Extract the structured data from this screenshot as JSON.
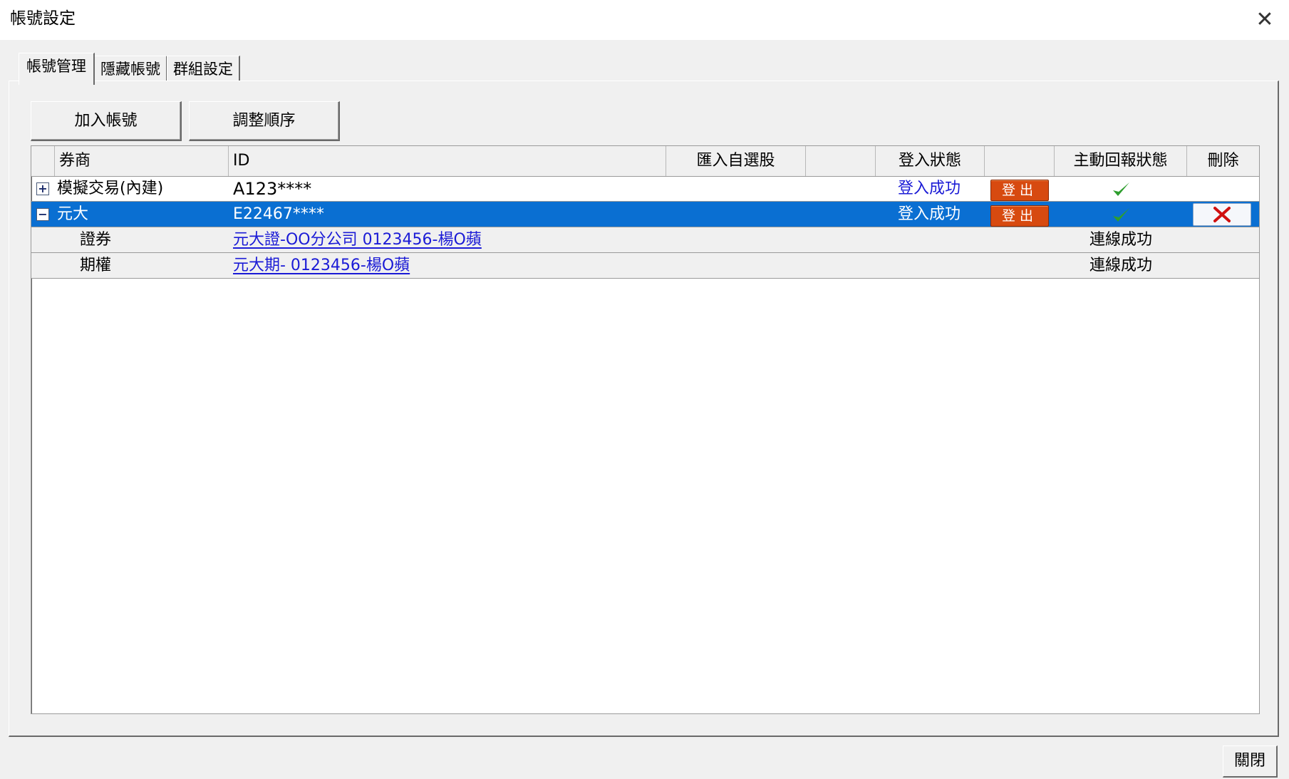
{
  "window": {
    "title": "帳號設定",
    "close_icon": "close-icon"
  },
  "tabs": [
    {
      "label": "帳號管理",
      "active": true
    },
    {
      "label": "隱藏帳號",
      "active": false
    },
    {
      "label": "群組設定",
      "active": false
    }
  ],
  "toolbar": {
    "add_label": "加入帳號",
    "reorder_label": "調整順序"
  },
  "columns": {
    "broker": "券商",
    "id": "ID",
    "import_watchlist": "匯入自選股",
    "blank1": "",
    "login_status": "登入狀態",
    "blank2": "",
    "report_status": "主動回報狀態",
    "delete": "刪除"
  },
  "rows": [
    {
      "expander": "+",
      "broker": "模擬交易(內建)",
      "id": "A123****",
      "login_status": "登入成功",
      "logout_label": "登出",
      "report_ok": true,
      "selected": false
    },
    {
      "expander": "−",
      "broker": "元大",
      "id": "E22467****",
      "login_status": "登入成功",
      "logout_label": "登出",
      "report_ok": true,
      "selected": true
    }
  ],
  "sub_rows": [
    {
      "type": "證券",
      "account": "元大證-OO分公司 0123456-楊O蘋",
      "status": "連線成功"
    },
    {
      "type": "期權",
      "account": "元大期- 0123456-楊O蘋",
      "status": "連線成功"
    }
  ],
  "colors": {
    "selected_row": "#0a6fd2",
    "logout_button": "#d74a10",
    "link": "#1b1bd6",
    "check": "#2e9e2e",
    "delete_x": "#d01010"
  },
  "footer": {
    "close_label": "關閉"
  }
}
